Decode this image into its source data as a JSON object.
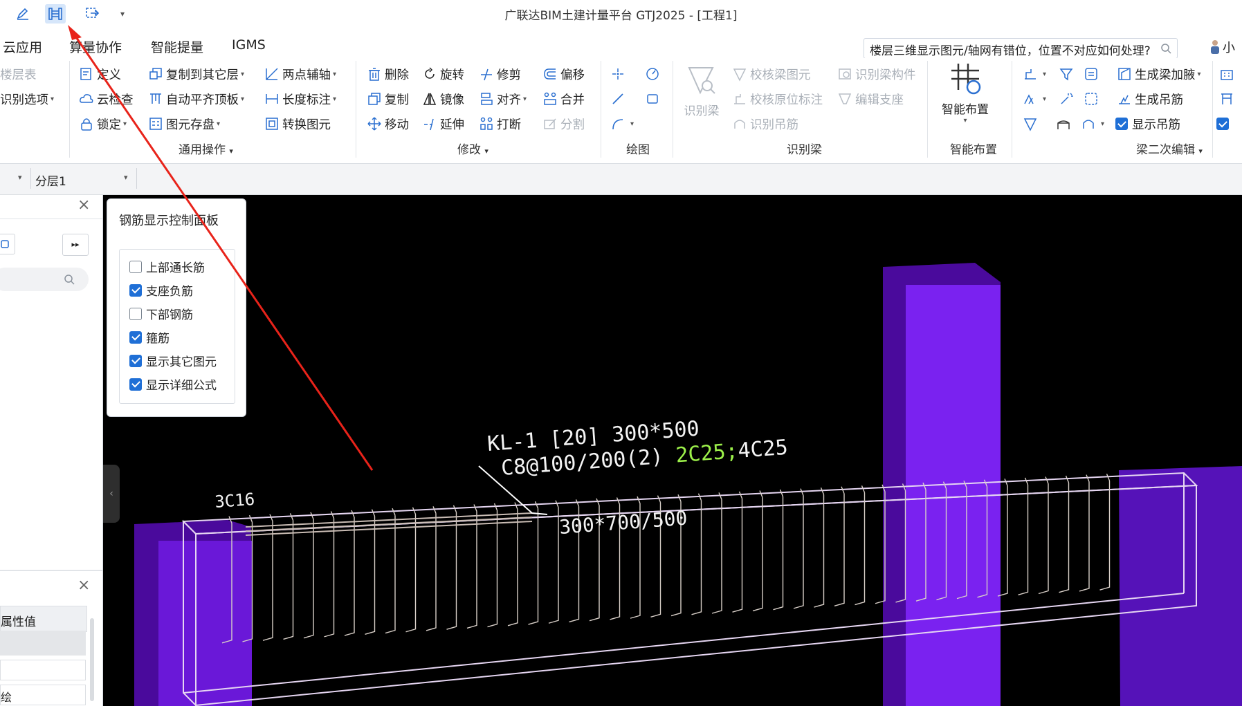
{
  "window": {
    "title": "广联达BIM土建计量平台 GTJ2025 - [工程1]"
  },
  "quick_access": {
    "more_caret": "▾"
  },
  "menu": [
    {
      "label": "云应用"
    },
    {
      "label": "算量协作"
    },
    {
      "label": "智能提量"
    },
    {
      "label": "IGMS"
    }
  ],
  "help": {
    "query": "楼层三维显示图元/轴网有错位，位置不对应如何处理?",
    "user": "小"
  },
  "ribbon": {
    "col0": [
      "楼层表",
      "识别选项"
    ],
    "general": {
      "items": [
        "定义",
        "复制到其它层",
        "两点辅轴",
        "云检查",
        "自动平齐顶板",
        "长度标注",
        "锁定",
        "图元存盘",
        "转换图元"
      ],
      "label": "通用操作"
    },
    "modify": {
      "items": [
        "删除",
        "旋转",
        "修剪",
        "偏移",
        "复制",
        "镜像",
        "对齐",
        "合并",
        "移动",
        "延伸",
        "打断",
        "分割"
      ],
      "label": "修改"
    },
    "draw": {
      "label": "绘图"
    },
    "recognize": {
      "big": "识别梁",
      "items": [
        "校核梁图元",
        "识别梁构件",
        "校核原位标注",
        "编辑支座",
        "识别吊筋"
      ],
      "label": "识别梁"
    },
    "smart": {
      "big": "智能布置",
      "label": "智能布置"
    },
    "beam_edit": {
      "items": [
        "生成梁加腋",
        "生成吊筋",
        "显示吊筋"
      ],
      "show_hanger_checked": true,
      "label": "梁二次编辑"
    }
  },
  "layerbar": {
    "layer": "分层1"
  },
  "left_panel": {
    "prop_header": "属性值",
    "prop_row3": "绘"
  },
  "rebar_panel": {
    "title": "钢筋显示控制面板",
    "options": [
      {
        "label": "上部通长筋",
        "checked": false
      },
      {
        "label": "支座负筋",
        "checked": true
      },
      {
        "label": "下部钢筋",
        "checked": false
      },
      {
        "label": "箍筋",
        "checked": true
      },
      {
        "label": "显示其它图元",
        "checked": true
      },
      {
        "label": "显示详细公式",
        "checked": true
      }
    ]
  },
  "viewport_labels": {
    "beam_line1": "KL-1 [20] 300*500",
    "beam_line2": "C8@100/200(2) ",
    "beam_line2_green": "2C25;",
    "beam_line2_end": "4C25",
    "left_support": "3C16",
    "section": "300*700/500"
  },
  "colors": {
    "column": "#6a18d8",
    "column_dark": "#4a0a9c",
    "rebar": "#d8cfc8",
    "beam": "#e6d6f2",
    "arrow": "#e8231a",
    "accent": "#1f6fd6"
  }
}
